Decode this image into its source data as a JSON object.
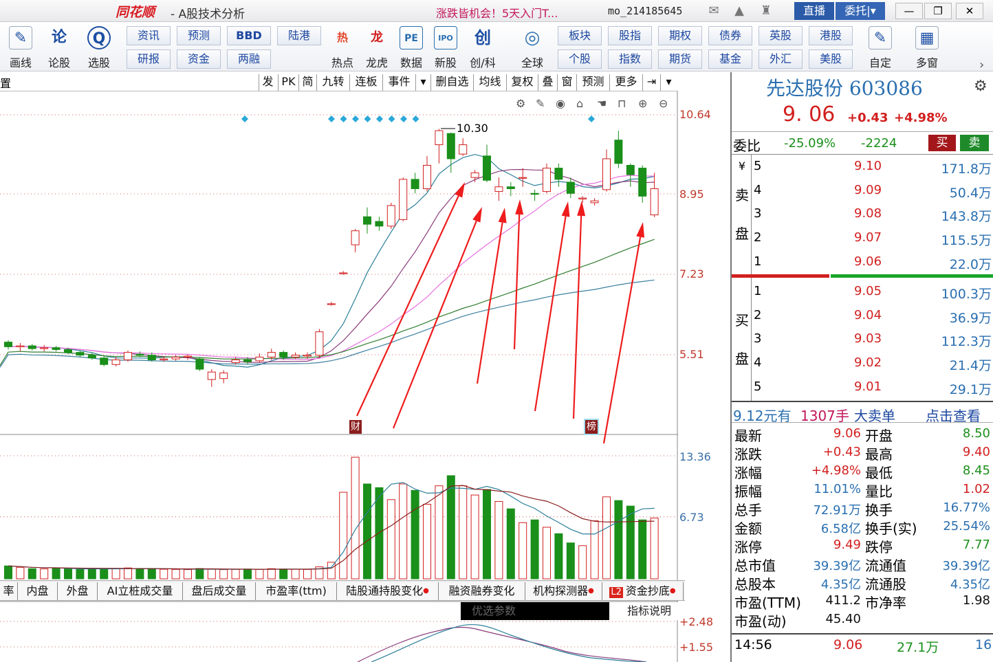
{
  "titlebar": {
    "logo": "同花顺",
    "title": "- A股技术分析",
    "promo": "涨跌皆机会！5天入门T...",
    "username": "mo_214185645",
    "live_label": "直播",
    "entrust_label": "委托|",
    "icons": [
      "mail-icon",
      "bell-icon",
      "shirt-icon"
    ],
    "window_buttons": [
      "—",
      "❐",
      "✕"
    ]
  },
  "toolbar": {
    "big": [
      {
        "name": "draw",
        "label": "画线",
        "icon": "✎",
        "color": "#1d4fa3"
      },
      {
        "name": "lungu",
        "label": "论股",
        "icon": "论",
        "color": "#1d4fa3"
      },
      {
        "name": "xuangu",
        "label": "选股",
        "icon": "Q",
        "color": "#1d4fa3"
      }
    ],
    "small_top": [
      "资讯",
      "预测",
      "BBD",
      "陆港"
    ],
    "small_bottom": [
      "研报",
      "资金",
      "两融",
      ""
    ],
    "mid": [
      {
        "label": "热点",
        "icon": "热",
        "color": "#e2462a"
      },
      {
        "label": "龙虎",
        "icon": "龙",
        "color": "#d21f1f"
      },
      {
        "label": "数据",
        "icon": "PE",
        "color": "#2a6fb0"
      },
      {
        "label": "新股",
        "icon": "IPO",
        "color": "#2a6fb0"
      },
      {
        "label": "创/科",
        "icon": "创",
        "color": "#1d4fa3"
      },
      {
        "label": "全球",
        "icon": "◎",
        "color": "#2a6fb0"
      }
    ],
    "small2_top": [
      "板块",
      "股指",
      "期权",
      "债券",
      "英股",
      "港股"
    ],
    "small2_bottom": [
      "个股",
      "指数",
      "期货",
      "基金",
      "外汇",
      "美股"
    ],
    "right": [
      {
        "label": "自定",
        "icon": "✎"
      },
      {
        "label": "多窗",
        "icon": "▦"
      }
    ]
  },
  "chart_toolbar": {
    "corner": "置",
    "buttons": [
      "发",
      "PK",
      "简",
      "九转",
      "连板",
      "事件",
      "▾",
      "删自选",
      "均线",
      "复权",
      "叠",
      "窗",
      "预测",
      "更多",
      "⇥",
      "▾"
    ],
    "icons": [
      "settings-icon",
      "pen-icon",
      "eye-icon",
      "basket-icon",
      "hand-icon",
      "lock-icon",
      "zoom-in-icon",
      "zoom-out-icon"
    ]
  },
  "price_axis": [
    "10.64",
    "8.95",
    "7.23",
    "5.51"
  ],
  "volume_axis": [
    "13.36",
    "6.73"
  ],
  "indicator_axis": [
    "+2.48",
    "+1.55"
  ],
  "annotations": {
    "high_label": "10.30",
    "marker_cai": "财",
    "marker_bang": "榜"
  },
  "indicator_tabs": [
    {
      "label": "率",
      "dot": false,
      "l2": false
    },
    {
      "label": "内盘",
      "dot": false,
      "l2": false
    },
    {
      "label": "外盘",
      "dot": false,
      "l2": false
    },
    {
      "label": "AI立桩成交量",
      "dot": false,
      "l2": false
    },
    {
      "label": "盘后成交量",
      "dot": false,
      "l2": false
    },
    {
      "label": "市盈率(ttm)",
      "dot": false,
      "l2": false
    },
    {
      "label": "陆股通持股变化",
      "dot": true,
      "l2": false
    },
    {
      "label": "融资融券变化",
      "dot": false,
      "l2": false
    },
    {
      "label": "机构探测器",
      "dot": true,
      "l2": false
    },
    {
      "label": "资金抄底",
      "dot": true,
      "l2": true
    }
  ],
  "indicator_params": {
    "params": "优选参数",
    "help": "指标说明"
  },
  "quote": {
    "name": "先达股份 603086",
    "price": "9. 06",
    "change": "+0.43",
    "change_pct": "+4.98%",
    "weibi_label": "委比",
    "weibi_pct": "-25.09%",
    "weibi_diff": "-2224",
    "buy_label": "买",
    "sell_label": "卖",
    "sell_side_label": [
      "¥",
      "卖",
      "盘"
    ],
    "buy_side_label": [
      "买",
      "盘"
    ],
    "asks": [
      {
        "lvl": "5",
        "price": "9.10",
        "qty": "171.8万"
      },
      {
        "lvl": "4",
        "price": "9.09",
        "qty": "50.4万"
      },
      {
        "lvl": "3",
        "price": "9.08",
        "qty": "143.8万"
      },
      {
        "lvl": "2",
        "price": "9.07",
        "qty": "115.5万"
      },
      {
        "lvl": "1",
        "price": "9.06",
        "qty": "22.0万"
      }
    ],
    "bids": [
      {
        "lvl": "1",
        "price": "9.05",
        "qty": "100.3万"
      },
      {
        "lvl": "2",
        "price": "9.04",
        "qty": "36.9万"
      },
      {
        "lvl": "3",
        "price": "9.03",
        "qty": "112.3万"
      },
      {
        "lvl": "4",
        "price": "9.02",
        "qty": "21.4万"
      },
      {
        "lvl": "5",
        "price": "9.01",
        "qty": "29.1万"
      }
    ],
    "big_order": {
      "price": "9.12元有",
      "volume": "1307手",
      "type": "大卖单",
      "link": "点击查看"
    },
    "stats": [
      {
        "k": "最新",
        "v": "9.06",
        "vc": "c-red",
        "k2": "开盘",
        "v2": "8.50",
        "v2c": "c-grn"
      },
      {
        "k": "涨跌",
        "v": "+0.43",
        "vc": "c-red",
        "k2": "最高",
        "v2": "9.40",
        "v2c": "c-red"
      },
      {
        "k": "涨幅",
        "v": "+4.98%",
        "vc": "c-red",
        "k2": "最低",
        "v2": "8.45",
        "v2c": "c-grn"
      },
      {
        "k": "振幅",
        "v": "11.01%",
        "vc": "c-blu",
        "k2": "量比",
        "v2": "1.02",
        "v2c": "c-red"
      },
      {
        "k": "总手",
        "v": "72.91万",
        "vc": "c-blu",
        "k2": "换手",
        "v2": "16.77%",
        "v2c": "c-blu"
      },
      {
        "k": "金额",
        "v": "6.58亿",
        "vc": "c-blu",
        "k2": "换手(实)",
        "v2": "25.54%",
        "v2c": "c-blu"
      },
      {
        "k": "涨停",
        "v": "9.49",
        "vc": "c-red",
        "k2": "跌停",
        "v2": "7.77",
        "v2c": "c-grn"
      },
      {
        "k": "总市值",
        "v": "39.39亿",
        "vc": "c-blu",
        "k2": "流通值",
        "v2": "39.39亿",
        "v2c": "c-blu"
      },
      {
        "k": "总股本",
        "v": "4.35亿",
        "vc": "c-blu",
        "k2": "流通股",
        "v2": "4.35亿",
        "v2c": "c-blu"
      },
      {
        "k": "市盈(TTM)",
        "v": "411.2",
        "vc": "c-blk",
        "k2": "市净率",
        "v2": "1.98",
        "v2c": "c-blk"
      },
      {
        "k": "市盈(动)",
        "v": "45.40",
        "vc": "c-blk",
        "k2": "",
        "v2": "",
        "v2c": "c-blk"
      }
    ],
    "tick": {
      "time": "14:56",
      "price": "9.06",
      "vol": "27.1万",
      "num": "16"
    }
  },
  "chart_data": {
    "type": "candlestick",
    "price_ticks": [
      10.64,
      8.95,
      7.23,
      5.51
    ],
    "candles": [
      [
        5.78,
        5.68,
        5.82,
        5.62
      ],
      [
        5.68,
        5.7,
        5.76,
        5.58
      ],
      [
        5.7,
        5.64,
        5.74,
        5.6
      ],
      [
        5.64,
        5.66,
        5.72,
        5.58
      ],
      [
        5.66,
        5.62,
        5.7,
        5.58
      ],
      [
        5.62,
        5.56,
        5.66,
        5.52
      ],
      [
        5.56,
        5.5,
        5.6,
        5.46
      ],
      [
        5.5,
        5.44,
        5.56,
        5.4
      ],
      [
        5.44,
        5.3,
        5.5,
        5.26
      ],
      [
        5.3,
        5.4,
        5.46,
        5.26
      ],
      [
        5.4,
        5.56,
        5.6,
        5.36
      ],
      [
        5.52,
        5.5,
        5.58,
        5.46
      ],
      [
        5.5,
        5.4,
        5.56,
        5.36
      ],
      [
        5.4,
        5.42,
        5.48,
        5.36
      ],
      [
        5.42,
        5.46,
        5.5,
        5.38
      ],
      [
        5.46,
        5.48,
        5.52,
        5.4
      ],
      [
        5.42,
        5.2,
        5.46,
        5.16
      ],
      [
        4.98,
        5.14,
        5.2,
        4.82
      ],
      [
        5.0,
        5.12,
        5.18,
        4.9
      ],
      [
        5.34,
        5.4,
        5.46,
        5.3
      ],
      [
        5.4,
        5.36,
        5.46,
        5.3
      ],
      [
        5.38,
        5.46,
        5.54,
        5.34
      ],
      [
        5.46,
        5.56,
        5.64,
        5.4
      ],
      [
        5.56,
        5.46,
        5.6,
        5.4
      ],
      [
        5.46,
        5.5,
        5.56,
        5.42
      ],
      [
        5.48,
        5.5,
        5.56,
        5.42
      ],
      [
        5.5,
        6.0,
        6.06,
        5.44
      ],
      [
        6.6,
        6.6,
        6.64,
        6.56
      ],
      [
        7.26,
        7.26,
        7.3,
        7.22
      ],
      [
        7.86,
        8.16,
        8.2,
        7.7
      ],
      [
        8.46,
        8.3,
        8.66,
        8.1
      ],
      [
        8.36,
        8.26,
        8.46,
        8.16
      ],
      [
        8.26,
        8.7,
        8.76,
        8.2
      ],
      [
        8.4,
        9.26,
        9.3,
        8.36
      ],
      [
        9.26,
        9.06,
        9.4,
        8.96
      ],
      [
        9.06,
        9.56,
        9.76,
        9.0
      ],
      [
        10.0,
        10.3,
        10.34,
        9.6
      ],
      [
        10.24,
        9.7,
        10.26,
        9.4
      ],
      [
        9.8,
        10.0,
        10.14,
        9.76
      ],
      [
        9.3,
        9.4,
        9.46,
        9.2
      ],
      [
        9.76,
        9.24,
        10.0,
        9.2
      ],
      [
        9.0,
        9.1,
        9.3,
        8.8
      ],
      [
        9.1,
        9.06,
        9.2,
        8.9
      ],
      [
        9.3,
        9.3,
        9.5,
        9.1
      ],
      [
        8.96,
        8.94,
        9.04,
        8.8
      ],
      [
        9.0,
        9.5,
        9.6,
        8.96
      ],
      [
        9.5,
        9.26,
        9.6,
        9.1
      ],
      [
        9.2,
        8.96,
        9.3,
        8.86
      ],
      [
        8.84,
        8.86,
        8.9,
        8.76
      ],
      [
        8.76,
        8.8,
        8.86,
        8.7
      ],
      [
        9.04,
        9.7,
        9.9,
        9.0
      ],
      [
        10.1,
        9.6,
        10.3,
        9.5
      ],
      [
        9.56,
        9.36,
        9.6,
        9.1
      ],
      [
        9.5,
        8.9,
        9.56,
        8.76
      ],
      [
        8.5,
        9.06,
        9.4,
        8.45
      ]
    ],
    "volume": [
      1.4,
      1.25,
      1.1,
      1.08,
      1.14,
      1.12,
      1.02,
      1.06,
      1.1,
      1.12,
      1.18,
      1.12,
      1.06,
      1.04,
      1.02,
      1.0,
      1.12,
      1.04,
      1.0,
      1.02,
      1.06,
      1.02,
      1.1,
      1.06,
      1.04,
      1.02,
      1.3,
      1.8,
      9.4,
      13.2,
      10.3,
      9.9,
      8.6,
      10.3,
      9.6,
      8.1,
      10.1,
      11.2,
      10.1,
      9.1,
      9.7,
      8.4,
      7.6,
      6.1,
      6.4,
      5.6,
      4.9,
      3.9,
      3.6,
      6.3,
      8.9,
      8.5,
      7.9,
      6.4,
      6.6
    ],
    "volume_ticks": [
      13.36,
      6.73
    ],
    "indicator_ticks": [
      2.48,
      1.55
    ]
  }
}
